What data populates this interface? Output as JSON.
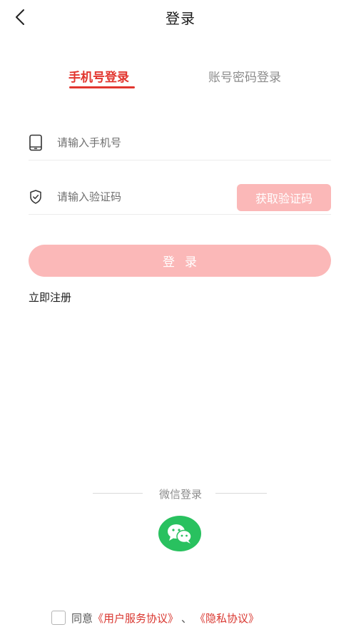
{
  "header": {
    "title": "登录",
    "back_icon": "chevron-left-icon"
  },
  "tabs": [
    {
      "label": "手机号登录",
      "active": true
    },
    {
      "label": "账号密码登录",
      "active": false
    }
  ],
  "phone_field": {
    "icon": "phone-icon",
    "placeholder": "请输入手机号",
    "value": ""
  },
  "code_field": {
    "icon": "shield-check-icon",
    "placeholder": "请输入验证码",
    "value": "",
    "button_label": "获取验证码"
  },
  "login_button_label": "登录",
  "register_link": "立即注册",
  "wechat": {
    "label": "微信登录",
    "icon": "wechat-icon"
  },
  "agreement": {
    "checked": false,
    "prefix": "同意",
    "user_agreement": "《用户服务协议》",
    "separator": "、",
    "privacy_policy": "《隐私协议》"
  },
  "colors": {
    "accent": "#e2362f",
    "button_disabled": "#fbb8b8",
    "wechat_green": "#29c15f"
  }
}
